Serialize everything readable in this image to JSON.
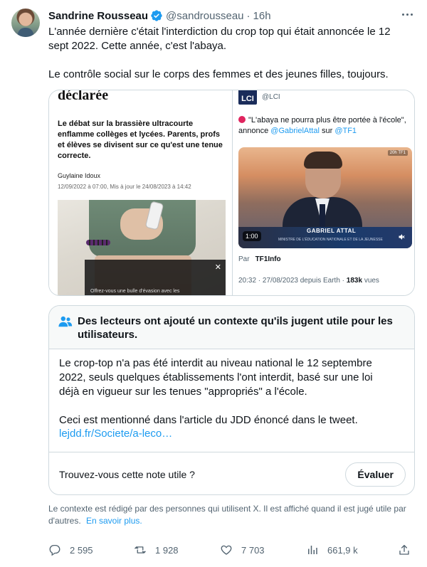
{
  "tweet": {
    "author_name": "Sandrine Rousseau",
    "author_handle": "@sandrousseau",
    "separator": "·",
    "time": "16h",
    "paragraph_1": "L'année dernière c'était l'interdiction du crop top qui était annoncée le 12 sept 2022. Cette année, c'est l'abaya.",
    "paragraph_2": "Le contrôle social sur le corps des femmes et des jeunes filles, toujours."
  },
  "media": {
    "left": {
      "headline": "déclarée",
      "lede": "Le débat sur la brassière ultracourte enflamme collèges et lycées. Parents, profs et élèves se divisent sur ce qu'est une tenue correcte.",
      "author": "Guylaine Idoux",
      "date": "12/09/2022 à 07:00, Mis à jour le 24/08/2023 à 14:42",
      "overlay_close": "✕",
      "overlay_text": "Offrez-vous une bulle d'évasion avec les"
    },
    "right": {
      "logo": "LCI",
      "handle": "@LCI",
      "quote": "\"L'abaya ne pourra plus être portée à l'école\", annonce",
      "mention_1": "@GabrielAttal",
      "sur": "sur",
      "mention_2": "@TF1",
      "video_channel": "20h TF1",
      "video_name": "GABRIEL ATTAL",
      "video_role": "MINISTRE DE L'ÉDUCATION NATIONALE ET DE LA JEUNESSE",
      "video_duration": "1:00",
      "source_prefix": "Par",
      "source_name": "TF1Info",
      "meta_time": "20:32 · 27/08/2023 depuis Earth ·",
      "meta_views": "183k",
      "meta_views_label": "vues"
    }
  },
  "note": {
    "title": "Des lecteurs ont ajouté un contexte qu'ils jugent utile pour les utilisateurs.",
    "body_1": "Le crop-top n'a pas été interdit au niveau national le 12 septembre 2022, seuls quelques établissements l'ont interdit, basé sur une loi déjà en vigueur sur les tenues \"appropriés\" a l'école.",
    "body_2": "Ceci est mentionné dans l'article du JDD énoncé dans le tweet.",
    "link": "lejdd.fr/Societe/a-leco…",
    "question": "Trouvez-vous cette note utile ?",
    "rate_button": "Évaluer"
  },
  "context": {
    "text": "Le contexte est rédigé par des personnes qui utilisent X. Il est affiché quand il est jugé utile par d'autres.",
    "link": "En savoir plus."
  },
  "actions": {
    "replies": "2 595",
    "reposts": "1 928",
    "likes": "7 703",
    "views": "661,9 k"
  },
  "colors": {
    "accent": "#1d9bf0",
    "text": "#0f1419",
    "muted": "#536471",
    "border": "#cfd9de"
  },
  "icons": [
    "verified-badge-icon",
    "more-icon",
    "people-icon",
    "reply-icon",
    "repost-icon",
    "like-icon",
    "views-icon",
    "share-icon",
    "mute-icon"
  ]
}
